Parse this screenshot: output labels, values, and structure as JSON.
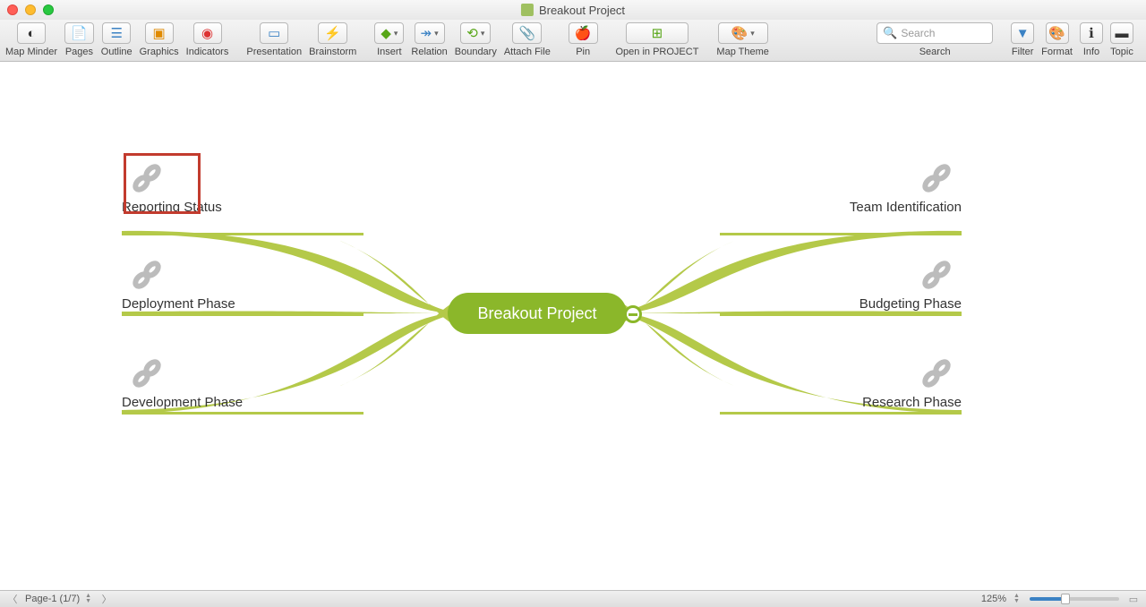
{
  "window": {
    "title": "Breakout Project"
  },
  "toolbar": {
    "map_minder": "Map Minder",
    "pages": "Pages",
    "outline": "Outline",
    "graphics": "Graphics",
    "indicators": "Indicators",
    "presentation": "Presentation",
    "brainstorm": "Brainstorm",
    "insert": "Insert",
    "relation": "Relation",
    "boundary": "Boundary",
    "attach_file": "Attach File",
    "pin": "Pin",
    "open_in_project": "Open in PROJECT",
    "map_theme": "Map Theme",
    "search": "Search",
    "search_placeholder": "Search",
    "filter": "Filter",
    "format": "Format",
    "info": "Info",
    "topic": "Topic"
  },
  "mindmap": {
    "central": "Breakout Project",
    "left": [
      {
        "label": "Reporting Status",
        "selected": true
      },
      {
        "label": "Deployment Phase",
        "selected": false
      },
      {
        "label": "Development Phase",
        "selected": false
      }
    ],
    "right": [
      {
        "label": "Team Identification",
        "selected": false
      },
      {
        "label": "Budgeting Phase",
        "selected": false
      },
      {
        "label": "Research Phase",
        "selected": false
      }
    ]
  },
  "status": {
    "page_label": "Page-1 (1/7)",
    "zoom": "125%"
  }
}
